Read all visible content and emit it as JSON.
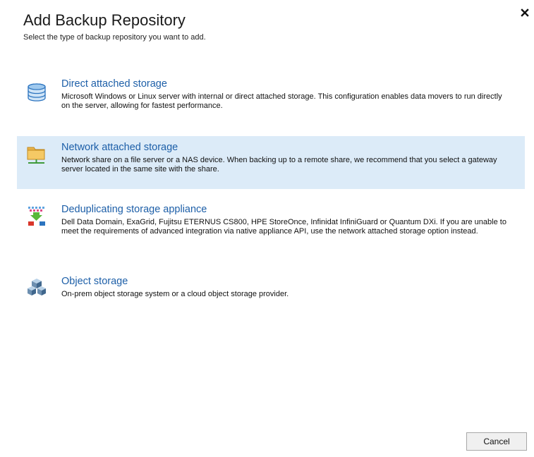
{
  "dialog": {
    "title": "Add Backup Repository",
    "subtitle": "Select the type of backup repository you want to add."
  },
  "options": [
    {
      "title": "Direct attached storage",
      "description": "Microsoft Windows or Linux server with internal or direct attached storage. This configuration enables data movers to run directly on the server, allowing for fastest performance.",
      "icon": "database-icon"
    },
    {
      "title": "Network attached storage",
      "description": "Network share on a file server or a NAS device. When backing up to a remote share, we recommend that you select a gateway server located in the same site with the share.",
      "icon": "network-folder-icon",
      "selected": true
    },
    {
      "title": "Deduplicating storage appliance",
      "description": "Dell Data Domain, ExaGrid, Fujitsu ETERNUS CS800, HPE StoreOnce, Infinidat InfiniGuard or Quantum DXi. If you are unable to meet the requirements of advanced integration via native appliance API, use the network attached storage option instead.",
      "icon": "dedup-appliance-icon"
    },
    {
      "title": "Object storage",
      "description": "On-prem object storage system or a cloud object storage provider.",
      "icon": "object-storage-cubes-icon"
    }
  ],
  "buttons": {
    "cancel": "Cancel"
  },
  "colors": {
    "accent": "#1d5fa8",
    "selected_bg": "#dcebf8"
  }
}
